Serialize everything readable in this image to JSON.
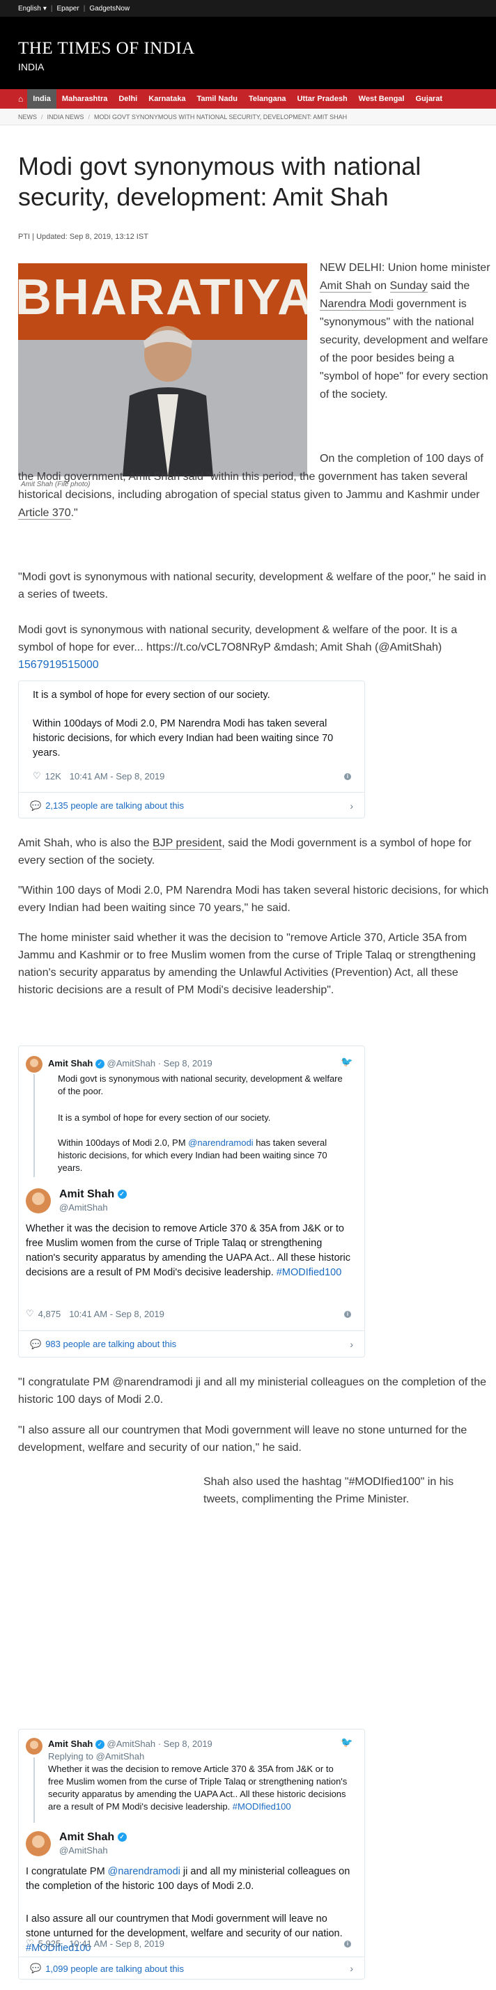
{
  "topbar": {
    "language": "English",
    "epaper": "Epaper",
    "gadgets": "GadgetsNow"
  },
  "brand": {
    "logo": "THE TIMES OF INDIA",
    "edition": "INDIA"
  },
  "nav": {
    "home_icon": "home-icon",
    "items": [
      "India",
      "Maharashtra",
      "Delhi",
      "Karnataka",
      "Tamil Nadu",
      "Telangana",
      "Uttar Pradesh",
      "West Bengal",
      "Gujarat"
    ]
  },
  "breadcrumb": [
    "NEWS",
    "INDIA NEWS",
    "MODI GOVT SYNONYMOUS WITH NATIONAL SECURITY, DEVELOPMENT: AMIT SHAH"
  ],
  "article": {
    "title": "Modi govt synonymous with national security, development: Amit Shah",
    "byline": "PTI | Updated: Sep 8, 2019, 13:12 IST",
    "photo_text": "BHARATIYA",
    "photo_caption": "Amit Shah (File photo)",
    "p1": {
      "a": "NEW DELHI: Union home minister ",
      "l1": "Amit Shah",
      "b": " on ",
      "l2": "Sunday",
      "c": " said the ",
      "l3": "Narendra Modi",
      "d": " government is \"synonymous\" with the national security, development and welfare of the poor besides being a \"symbol of hope\" for every section of the society."
    },
    "p2": {
      "a": "On the completion of 100 days of the Modi government, Amit Shah said \"within this period, the government has taken several historical decisions, including abrogation of special status given to Jammu and Kashmir under ",
      "l1": "Article 370",
      "b": ".\""
    },
    "p3": "\"Modi govt is synonymous with national security, development & welfare of the poor,\" he said in a series of tweets.",
    "p4": {
      "a": "Modi govt is synonymous with national security, development & welfare of the poor. It is a symbol of hope for ever... https://t.co/vCL7O8NRyP &mdash; Amit Shah (@AmitShah) ",
      "l1": "1567919515000"
    },
    "p5": {
      "a": "Amit Shah, who is also the ",
      "l1": "BJP president",
      "b": ", said the Modi government is a symbol of hope for every section of the society."
    },
    "p6": "\"Within 100 days of Modi 2.0, PM Narendra Modi has taken several historic decisions, for which every Indian had been waiting since 70 years,\" he said.",
    "p7": "The home minister said whether it was the decision to \"remove Article 370, Article 35A from Jammu and Kashmir or to free Muslim women from the curse of Triple Talaq or strengthening nation's security apparatus by amending the Unlawful Activities (Prevention) Act, all these historic decisions are a result of PM Modi's decisive leadership\".",
    "p8": "\"I congratulate PM @narendramodi ji and all my ministerial colleagues on the completion of the historic 100 days of Modi 2.0.",
    "p9": "\"I also assure all our countrymen that Modi government will leave no stone unturned for the development, welfare and security of our nation,\" he said.",
    "p10": "Shah also used the hashtag \"#MODIfied100\" in his tweets, complimenting the Prime Minister."
  },
  "tweet1": {
    "line1": "It is a symbol of hope for every section of our society.",
    "line2": "Within 100days of Modi 2.0, PM Narendra Modi has taken several historic decisions, for which every Indian had been waiting since 70 years.",
    "likes": "12K",
    "time": "10:41 AM - Sep 8, 2019",
    "talking": "2,135 people are talking about this"
  },
  "tweet2": {
    "quote_name": "Amit Shah",
    "quote_handle": "@AmitShah · Sep 8, 2019",
    "quote_l1": "Modi govt is synonymous with national security, development & welfare of the poor.",
    "quote_l2": "It is a symbol of hope for every section of our society.",
    "quote_l3a": "Within 100days of Modi 2.0, PM ",
    "quote_mention": "@narendramodi",
    "quote_l3b": " has taken several historic decisions, for which every Indian had been waiting since 70 years.",
    "name": "Amit Shah",
    "handle": "@AmitShah",
    "body": "Whether it was the decision to remove Article 370 & 35A from J&K or to free Muslim women from the curse of Triple Talaq or strengthening nation's security apparatus by amending the UAPA Act.. All these historic decisions are a result of PM Modi's decisive leadership. ",
    "hashtag": "#MODIfied100",
    "likes": "4,875",
    "time": "10:41 AM - Sep 8, 2019",
    "talking": "983 people are talking about this"
  },
  "tweet3": {
    "quote_name": "Amit Shah",
    "quote_handle": "@AmitShah · Sep 8, 2019",
    "replying": "Replying to @AmitShah",
    "quote_body": "Whether it was the decision to remove Article 370 & 35A from J&K or to free Muslim women from the curse of Triple Talaq or strengthening nation's security apparatus by amending the UAPA Act.. All these historic decisions are a result of PM Modi's decisive leadership. ",
    "quote_hashtag": "#MODIfied100",
    "name": "Amit Shah",
    "handle": "@AmitShah",
    "body1a": "I congratulate PM ",
    "body1m": "@narendramodi",
    "body1b": " ji and all my ministerial colleagues on the completion of the historic 100 days of Modi 2.0.",
    "body2": "I also assure all our countrymen that Modi government will leave no stone unturned for the development, welfare and security of our nation. ",
    "hashtag": "#MODIfied100",
    "likes": "5,925",
    "time": "10:41 AM - Sep 8, 2019",
    "talking": "1,099 people are talking about this"
  },
  "colors": {
    "nav_red": "#c52429",
    "link_blue": "#1b6ac2",
    "twitter_blue": "#1da1f2"
  }
}
